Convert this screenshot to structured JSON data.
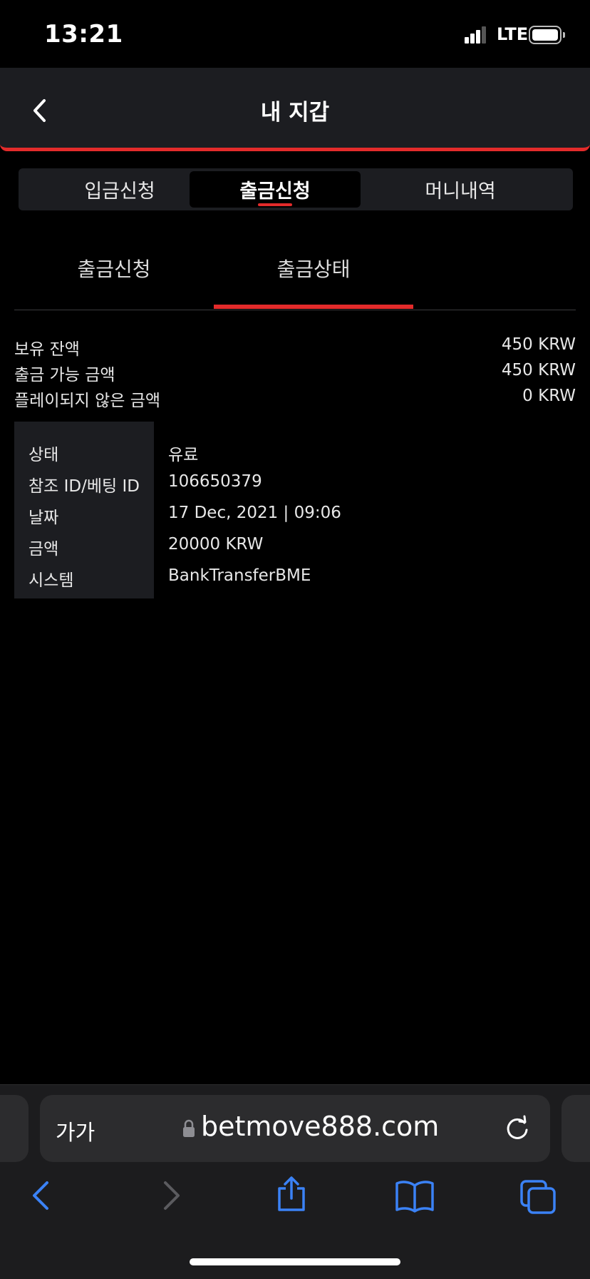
{
  "status_bar": {
    "time": "13:21",
    "network": "LTE"
  },
  "header": {
    "title": "내 지갑"
  },
  "main_tabs": [
    {
      "label": "입금신청",
      "active": false
    },
    {
      "label": "출금신청",
      "active": true
    },
    {
      "label": "머니내역",
      "active": false
    }
  ],
  "sub_tabs": [
    {
      "label": "출금신청",
      "active": false
    },
    {
      "label": "출금상태",
      "active": true
    }
  ],
  "balances": [
    {
      "label": "보유 잔액",
      "value": "450 KRW"
    },
    {
      "label": "출금 가능 금액",
      "value": "450 KRW"
    },
    {
      "label": "플레이되지 않은 금액",
      "value": "0 KRW"
    }
  ],
  "details": [
    {
      "label": "상태",
      "value": "유료"
    },
    {
      "label": "참조 ID/베팅 ID",
      "value": "106650379"
    },
    {
      "label": "날짜",
      "value": "17 Dec, 2021 | 09:06"
    },
    {
      "label": "금액",
      "value": "20000 KRW"
    },
    {
      "label": "시스템",
      "value": "BankTransferBME"
    }
  ],
  "browser": {
    "text_size_label": "가가",
    "url": "betmove888.com"
  },
  "colors": {
    "accent": "#e32b2b",
    "panel": "#1c1d21",
    "ios_blue": "#3b82f6"
  }
}
